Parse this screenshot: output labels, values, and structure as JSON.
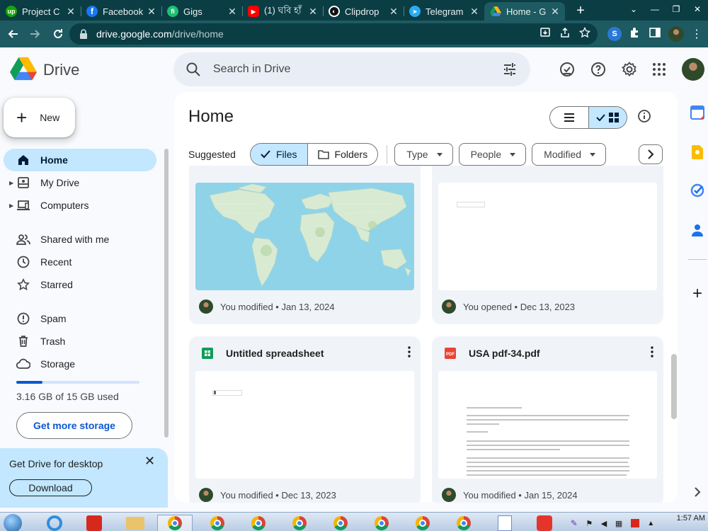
{
  "browser": {
    "tabs": [
      {
        "title": "Project C",
        "icon": "upwork-icon",
        "color": "#14a800",
        "glyph": "up"
      },
      {
        "title": "Facebook",
        "icon": "facebook-icon",
        "color": "#1877f2",
        "glyph": "f"
      },
      {
        "title": "Gigs",
        "icon": "fiverr-icon",
        "color": "#1dbf73",
        "glyph": "fi"
      },
      {
        "title": "(1) ঘবি হাঁ",
        "icon": "youtube-icon",
        "color": "#ff0000",
        "glyph": "▶"
      },
      {
        "title": "Clipdrop",
        "icon": "clipdrop-icon",
        "color": "#111111",
        "glyph": "◐"
      },
      {
        "title": "Telegram",
        "icon": "telegram-icon",
        "color": "#2aabee",
        "glyph": "➤"
      },
      {
        "title": "Home - G",
        "icon": "google-drive-icon",
        "color": "#ffffff",
        "glyph": "▲"
      }
    ],
    "url_host": "drive.google.com",
    "url_path": "/drive/home"
  },
  "app": {
    "name": "Drive",
    "search_placeholder": "Search in Drive"
  },
  "sidebar": {
    "new_label": "New",
    "items": [
      {
        "label": "Home",
        "icon": "home-icon",
        "active": true
      },
      {
        "label": "My Drive",
        "icon": "my-drive-icon"
      },
      {
        "label": "Computers",
        "icon": "computer-icon"
      },
      {
        "label": "Shared with me",
        "icon": "shared-icon"
      },
      {
        "label": "Recent",
        "icon": "clock-icon"
      },
      {
        "label": "Starred",
        "icon": "star-icon"
      },
      {
        "label": "Spam",
        "icon": "spam-icon"
      },
      {
        "label": "Trash",
        "icon": "trash-icon"
      },
      {
        "label": "Storage",
        "icon": "cloud-icon"
      }
    ],
    "storage_text": "3.16 GB of 15 GB used",
    "storage_fraction": 0.21,
    "get_storage_label": "Get more storage",
    "promo_title": "Get Drive for desktop",
    "promo_button": "Download"
  },
  "main": {
    "title": "Home",
    "suggested_label": "Suggested",
    "seg_files": "Files",
    "seg_folders": "Folders",
    "filters": [
      "Type",
      "People",
      "Modified"
    ],
    "cards": [
      {
        "name": "",
        "type": "map",
        "activity": "You modified • Jan 13, 2024"
      },
      {
        "name": "",
        "type": "doc",
        "activity": "You opened • Dec 13, 2023"
      },
      {
        "name": "Untitled spreadsheet",
        "type": "sheet",
        "activity": "You modified • Dec 13, 2023"
      },
      {
        "name": "USA pdf-34.pdf",
        "type": "pdf",
        "activity": "You modified • Jan 15, 2024"
      }
    ]
  },
  "taskbar": {
    "time": "1:57 AM"
  },
  "colors": {
    "accent": "#0b57d0",
    "selected": "#c2e7ff",
    "chrome_dark": "#0b3d44",
    "chrome_toolbar": "#1e5a61"
  }
}
